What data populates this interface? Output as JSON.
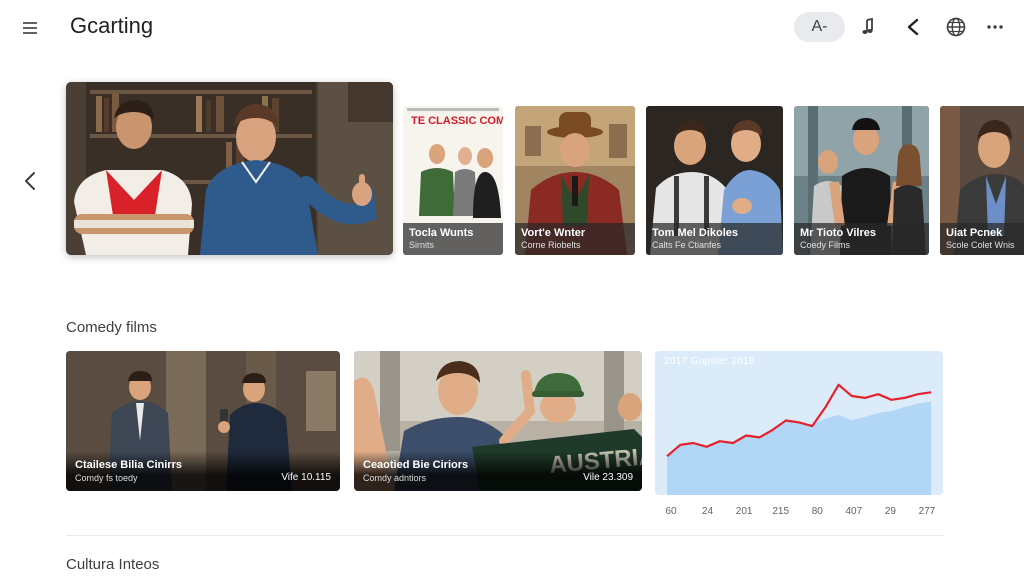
{
  "header": {
    "title": "Gcarting",
    "pill_label": "A-",
    "icons": [
      "menu-icon",
      "music-note-icon",
      "share-icon",
      "globe-icon",
      "more-icon"
    ]
  },
  "hero": {
    "scene": "two-men-bookshelf"
  },
  "tiles": [
    {
      "poster_title": "TE CLASSIC COMEDY",
      "title": "Tocla Wunts",
      "subtitle": "Sirnits"
    },
    {
      "title": "Vort'e Wnter",
      "subtitle": "Corne Riobelts"
    },
    {
      "title": "Tom Mel Dikoles",
      "subtitle": "Calts Fe Ctianfes"
    },
    {
      "title": "Mr Tioto Vilres",
      "subtitle": "Coedy Films"
    },
    {
      "title": "Uiat Pcnek",
      "subtitle": "Scole Colet Wnis"
    }
  ],
  "sections": {
    "comedy_title": "Comedy films",
    "second_title": "Cultura Inteos"
  },
  "cards": [
    {
      "title": "Ctailese Bilia Cinirrs",
      "subtitle": "Comdy fs toedy",
      "meta": "Vife 10.115"
    },
    {
      "title": "Ceaotied Bie Ciriors",
      "subtitle": "Comdy adntiors",
      "meta": "Vile 23.309",
      "sign_text": "AUSTRIA"
    }
  ],
  "chart_data": {
    "type": "area",
    "title": "2017 Gopster 2019",
    "x": [
      "60",
      "24",
      "201",
      "215",
      "80",
      "407",
      "29",
      "277"
    ],
    "series": [
      {
        "values": [
          1.0,
          1.6,
          1.7,
          1.5,
          1.8,
          1.7,
          2.1,
          2.0,
          2.4,
          2.9,
          2.8,
          2.7,
          3.0,
          3.2,
          2.9,
          3.1,
          3.3,
          3.4,
          3.6,
          3.8,
          3.9
        ]
      },
      {
        "values": [
          1.0,
          1.6,
          1.7,
          1.5,
          1.8,
          1.7,
          2.1,
          2.0,
          2.4,
          2.9,
          2.8,
          2.6,
          3.6,
          4.8,
          4.2,
          4.1,
          4.3,
          4.0,
          4.1,
          4.3,
          4.4
        ]
      }
    ],
    "colors": {
      "line": "#e5222c",
      "area": "#a9d2f5",
      "background": "#dcebfa"
    }
  }
}
